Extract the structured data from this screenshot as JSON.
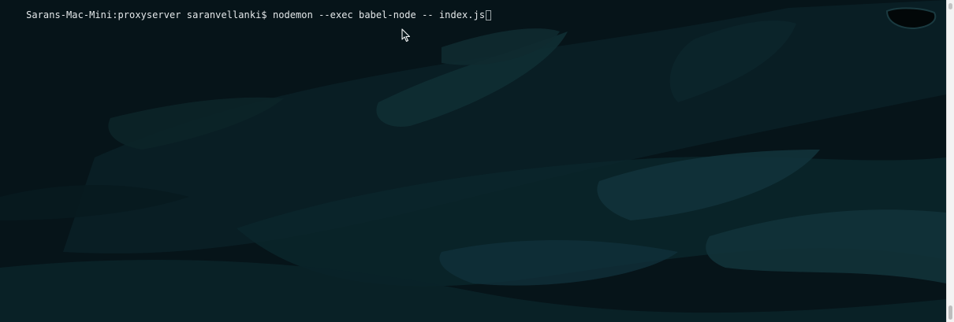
{
  "terminal": {
    "prompt": "Sarans-Mac-Mini:proxyserver saranvellanki$",
    "command": "nodemon --exec babel-node -- index.js"
  },
  "colors": {
    "background": "#071419",
    "text": "#e4e8ea",
    "scrollbar": "#f3f3f3"
  },
  "icons": {
    "pointer": "mouse-pointer-icon",
    "cursor": "text-cursor-block"
  }
}
